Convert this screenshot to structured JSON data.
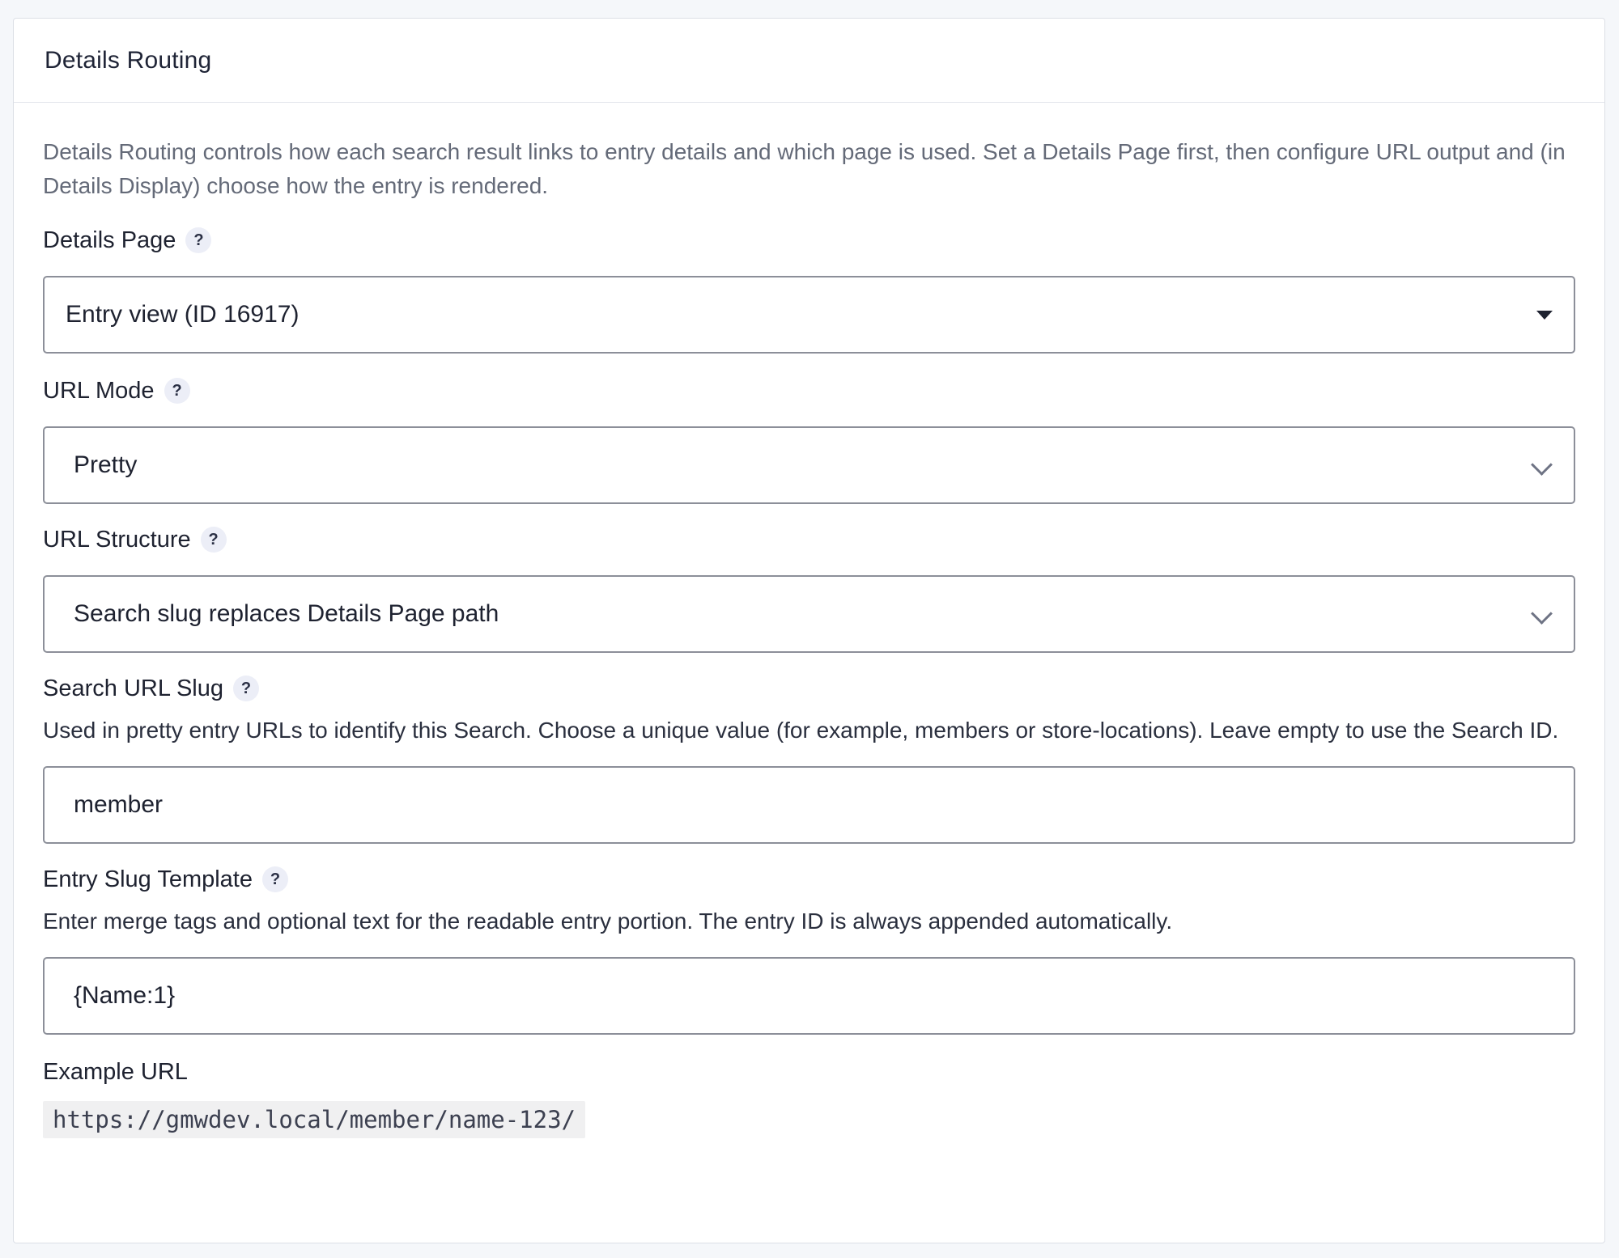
{
  "panel": {
    "title": "Details Routing",
    "intro": "Details Routing controls how each search result links to entry details and which page is used. Set a Details Page first, then configure URL output and (in Details Display) choose how the entry is rendered."
  },
  "fields": {
    "details_page": {
      "label": "Details Page",
      "help": "?",
      "value": "Entry view (ID 16917)"
    },
    "url_mode": {
      "label": "URL Mode",
      "help": "?",
      "value": "Pretty"
    },
    "url_structure": {
      "label": "URL Structure",
      "help": "?",
      "value": "Search slug replaces Details Page path"
    },
    "search_url_slug": {
      "label": "Search URL Slug",
      "help": "?",
      "description": "Used in pretty entry URLs to identify this Search. Choose a unique value (for example, members or store-locations). Leave empty to use the Search ID.",
      "value": "member"
    },
    "entry_slug_template": {
      "label": "Entry Slug Template",
      "help": "?",
      "description": "Enter merge tags and optional text for the readable entry portion. The entry ID is always appended automatically.",
      "value": "{Name:1}"
    },
    "example_url": {
      "label": "Example URL",
      "value": "https://gmwdev.local/member/name-123/"
    }
  },
  "icons": {
    "help": "question-mark-icon",
    "select_caret": "caret-down-icon",
    "select_chevron": "chevron-down-icon"
  }
}
